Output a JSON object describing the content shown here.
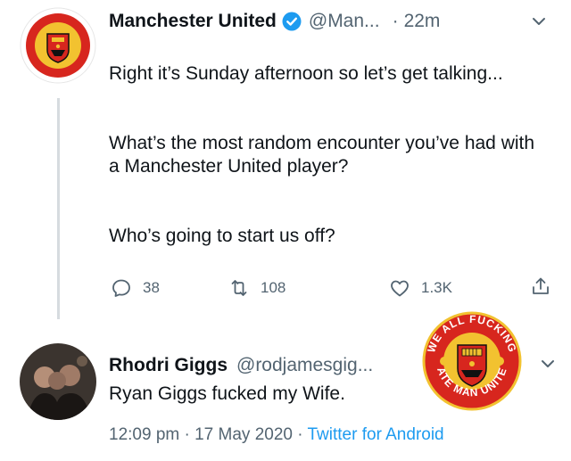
{
  "tweet": {
    "display_name": "Manchester United",
    "handle": "@Man...",
    "separator": "·",
    "time": "22m",
    "paragraphs": [
      "Right it’s Sunday afternoon so let’s get talking...",
      "What’s the most random encounter you’ve had with a Manchester United player?",
      "Who’s going to start us off?"
    ],
    "avatar_icon": "manchester-united-crest",
    "badge_icon": "verified-badge",
    "actions": {
      "replies": "38",
      "retweets": "108",
      "likes": "1.3K"
    }
  },
  "reply": {
    "display_name": "Rhodri Giggs",
    "handle": "@rodjamesgig...",
    "text": "Ryan Giggs fucked my Wife.",
    "timestamp": "12:09 pm · 17 May 2020 · ",
    "source": "Twitter for Android"
  },
  "overlay": {
    "logo_top_text": "WE ALL FUCKING",
    "logo_bottom_text": "HATE MAN UNITED",
    "logo_icon": "hate-man-united-crest"
  },
  "colors": {
    "text": "#0f1419",
    "secondary": "#536471",
    "accent": "#1d9bf0",
    "thread_line": "#d6dbdf",
    "crest_red": "#d7261e",
    "crest_gold": "#f2c230"
  }
}
